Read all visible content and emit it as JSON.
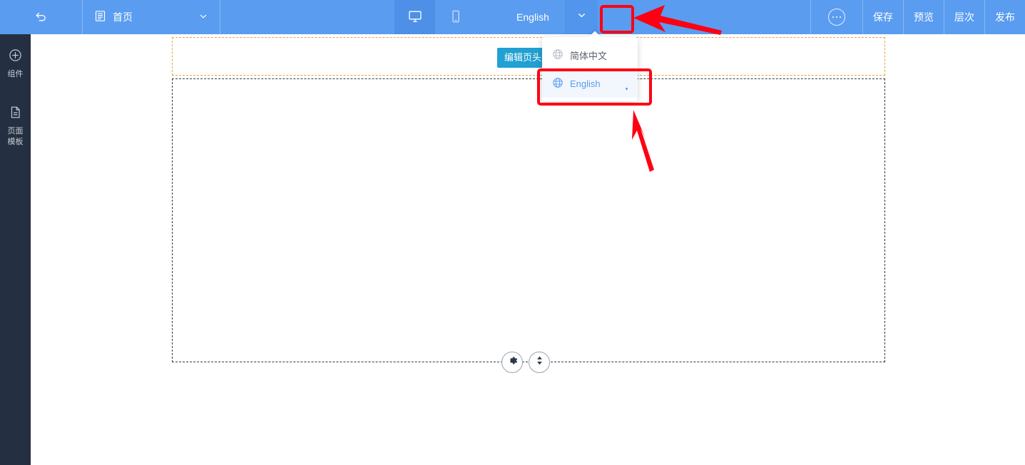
{
  "topbar": {
    "undo_icon": "undo-arrow-icon",
    "page_selector": {
      "icon": "page-list-icon",
      "label": "首页",
      "chevron": "chevron-down-icon"
    },
    "devices": [
      {
        "name": "desktop",
        "icon": "desktop-monitor-icon",
        "active": true
      },
      {
        "name": "mobile",
        "icon": "mobile-phone-icon",
        "active": false
      }
    ],
    "language": {
      "current": "English",
      "chevron": "chevron-down-icon"
    },
    "more_icon": "more-horizontal-icon",
    "actions": [
      {
        "label": "保存"
      },
      {
        "label": "预览"
      },
      {
        "label": "层次"
      },
      {
        "label": "发布"
      }
    ]
  },
  "sidebar": {
    "items": [
      {
        "icon": "plus-circle-icon",
        "label": "组件"
      },
      {
        "icon": "page-document-icon",
        "label": "页面\n模板",
        "line1": "页面",
        "line2": "模板"
      }
    ]
  },
  "canvas": {
    "edit_header_button": "编辑页头页",
    "zone_tools": [
      {
        "name": "settings",
        "icon": "gear-icon"
      },
      {
        "name": "move-vertical",
        "icon": "up-down-arrows-icon"
      }
    ]
  },
  "language_dropdown": {
    "items": [
      {
        "label": "简体中文",
        "icon": "globe-icon",
        "selected": false
      },
      {
        "label": "English",
        "icon": "globe-icon",
        "selected": true
      }
    ]
  },
  "colors": {
    "topbar_blue": "#5a9cf0",
    "topbar_active_blue": "#4e90e8",
    "sidebar_navy": "#242f41",
    "accent_cyan": "#21a0d2",
    "annotation_red": "#ff0012",
    "header_zone_border": "#e8a33d",
    "body_zone_border": "#333a45",
    "selected_item_blue": "#5a9cf0"
  }
}
